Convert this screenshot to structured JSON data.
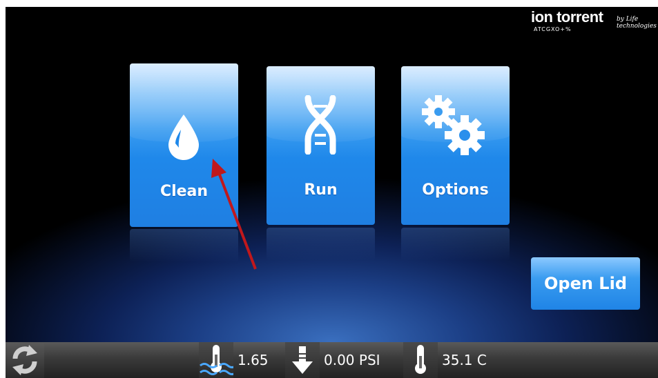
{
  "logo": {
    "brand": "ion torrent",
    "by": "by Life technologies",
    "glyphs": "ATCGXO+%"
  },
  "tiles": {
    "clean": {
      "label": "Clean",
      "icon": "water-drop-icon"
    },
    "run": {
      "label": "Run",
      "icon": "dna-helix-icon"
    },
    "options": {
      "label": "Options",
      "icon": "gears-icon"
    }
  },
  "open_lid": {
    "label": "Open Lid"
  },
  "statusbar": {
    "level": "1.65",
    "pressure": "0.00 PSI",
    "temperature": "35.1 C"
  },
  "colors": {
    "tile_blue": "#1f88ea",
    "annotation_arrow": "#c0181c"
  }
}
